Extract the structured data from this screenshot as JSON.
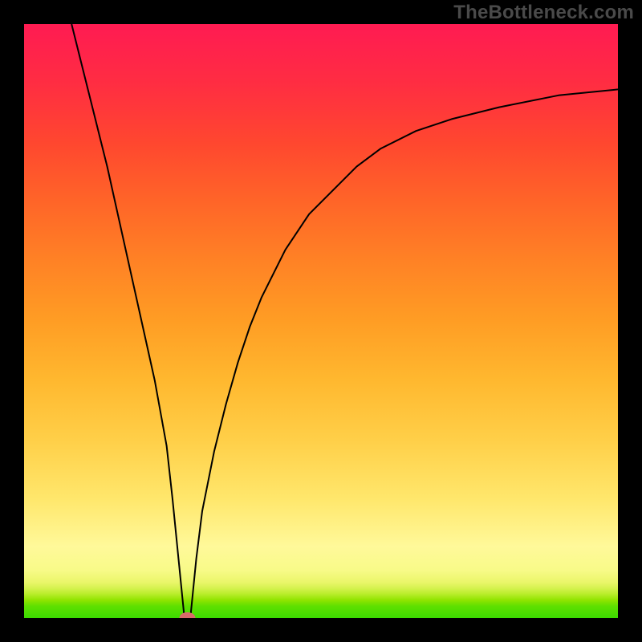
{
  "watermark": "TheBottleneck.com",
  "chart_data": {
    "type": "line",
    "title": "",
    "xlabel": "",
    "ylabel": "",
    "xlim": [
      0,
      100
    ],
    "ylim": [
      0,
      100
    ],
    "grid": false,
    "gradient_bands": [
      {
        "y": 0,
        "color": "#3cdb00"
      },
      {
        "y": 2,
        "color": "#5fe000"
      },
      {
        "y": 3,
        "color": "#90e400"
      },
      {
        "y": 4,
        "color": "#b8ed2a"
      },
      {
        "y": 5,
        "color": "#d5f24e"
      },
      {
        "y": 6,
        "color": "#eaf66a"
      },
      {
        "y": 8,
        "color": "#f8fa88"
      },
      {
        "y": 12,
        "color": "#fff99a"
      },
      {
        "y": 20,
        "color": "#ffe76c"
      },
      {
        "y": 30,
        "color": "#ffcf48"
      },
      {
        "y": 40,
        "color": "#ffb82f"
      },
      {
        "y": 50,
        "color": "#ff9d24"
      },
      {
        "y": 60,
        "color": "#ff8225"
      },
      {
        "y": 70,
        "color": "#ff6528"
      },
      {
        "y": 80,
        "color": "#ff472f"
      },
      {
        "y": 90,
        "color": "#ff2d42"
      },
      {
        "y": 100,
        "color": "#ff1b52"
      }
    ],
    "series": [
      {
        "name": "curve",
        "type": "line",
        "color": "#000000",
        "x": [
          8,
          10,
          12,
          14,
          16,
          18,
          20,
          22,
          24,
          25,
          26,
          27,
          28,
          29,
          30,
          32,
          34,
          36,
          38,
          40,
          44,
          48,
          52,
          56,
          60,
          66,
          72,
          80,
          90,
          100
        ],
        "y": [
          100,
          92,
          84,
          76,
          67,
          58,
          49,
          40,
          29,
          20,
          10,
          0,
          0,
          10,
          18,
          28,
          36,
          43,
          49,
          54,
          62,
          68,
          72,
          76,
          79,
          82,
          84,
          86,
          88,
          89
        ]
      },
      {
        "name": "marker",
        "type": "scatter",
        "color": "#d86a6a",
        "x": [
          27.5
        ],
        "y": [
          0
        ]
      }
    ]
  }
}
